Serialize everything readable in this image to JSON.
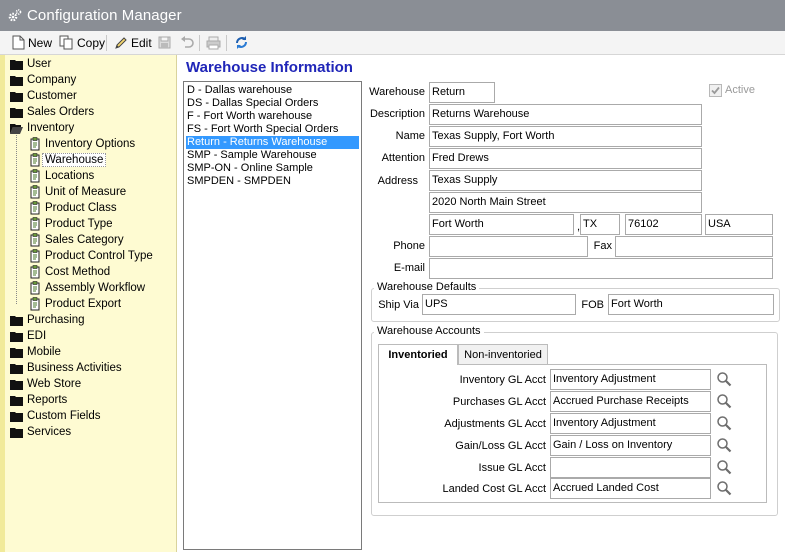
{
  "window": {
    "title": "Configuration Manager",
    "icon": "gear-icon"
  },
  "toolbar": {
    "new_label": "New",
    "copy_label": "Copy",
    "edit_label": "Edit"
  },
  "tree": {
    "top": [
      {
        "label": "User"
      },
      {
        "label": "Company"
      },
      {
        "label": "Customer"
      },
      {
        "label": "Sales Orders"
      },
      {
        "label": "Inventory"
      }
    ],
    "inventory_children": [
      {
        "label": "Inventory Options"
      },
      {
        "label": "Warehouse"
      },
      {
        "label": "Locations"
      },
      {
        "label": "Unit of Measure"
      },
      {
        "label": "Product Class"
      },
      {
        "label": "Product Type"
      },
      {
        "label": "Sales Category"
      },
      {
        "label": "Product Control Type"
      },
      {
        "label": "Cost Method"
      },
      {
        "label": "Assembly Workflow"
      },
      {
        "label": "Product Export"
      }
    ],
    "bottom": [
      {
        "label": "Purchasing"
      },
      {
        "label": "EDI"
      },
      {
        "label": "Mobile"
      },
      {
        "label": "Business Activities"
      },
      {
        "label": "Web Store"
      },
      {
        "label": "Reports"
      },
      {
        "label": "Custom Fields"
      },
      {
        "label": "Services"
      }
    ],
    "selected": "Warehouse"
  },
  "main": {
    "title": "Warehouse Information",
    "warehouses": [
      "D - Dallas warehouse",
      "DS - Dallas Special Orders",
      "F - Fort Worth warehouse",
      "FS - Fort Worth Special Orders",
      "Return - Returns Warehouse",
      "SMP - Sample Warehouse",
      "SMP-ON - Online Sample",
      "SMPDEN - SMPDEN"
    ],
    "selected_index": 4
  },
  "form": {
    "warehouse_label": "Warehouse",
    "warehouse_value": "Return",
    "active_label": "Active",
    "active_checked": true,
    "description_label": "Description",
    "description_value": "Returns Warehouse",
    "name_label": "Name",
    "name_value": "Texas Supply, Fort Worth",
    "attention_label": "Attention",
    "attention_value": "Fred Drews",
    "address_label": "Address",
    "address1_value": "Texas Supply",
    "address2_value": "2020 North Main Street",
    "city_value": "Fort Worth",
    "city_sep": ",",
    "state_value": "TX",
    "zip_value": "76102",
    "country_value": "USA",
    "phone_label": "Phone",
    "phone_value": "",
    "fax_label": "Fax",
    "fax_value": "",
    "email_label": "E-mail",
    "email_value": ""
  },
  "defaults": {
    "legend": "Warehouse Defaults",
    "ship_via_label": "Ship Via",
    "ship_via_value": "UPS",
    "fob_label": "FOB",
    "fob_value": "Fort Worth"
  },
  "accounts": {
    "legend": "Warehouse Accounts",
    "tabs": [
      "Inventoried",
      "Non-inventoried"
    ],
    "active_tab": 0,
    "rows": [
      {
        "label": "Inventory GL Acct",
        "value": "Inventory Adjustment"
      },
      {
        "label": "Purchases GL Acct",
        "value": "Accrued Purchase Receipts"
      },
      {
        "label": "Adjustments GL Acct",
        "value": "Inventory Adjustment"
      },
      {
        "label": "Gain/Loss GL Acct",
        "value": "Gain / Loss on Inventory"
      },
      {
        "label": "Issue GL Acct",
        "value": ""
      },
      {
        "label": "Landed Cost GL Acct",
        "value": "Accrued Landed Cost"
      }
    ]
  }
}
